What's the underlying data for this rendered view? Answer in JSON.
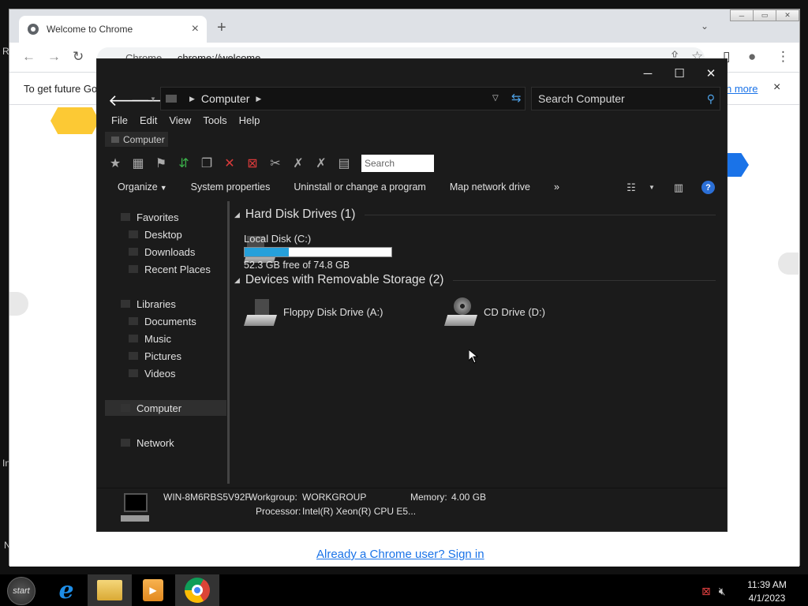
{
  "desktop": {
    "frag1": "R",
    "frag2": "In",
    "frag3": "N"
  },
  "chrome": {
    "tab_title": "Welcome to Chrome",
    "tab_close": "×",
    "new_tab": "+",
    "tab_search": "⌄",
    "win_min": "─",
    "win_max": "▭",
    "win_close": "✕",
    "site_label": "Chrome",
    "url": "chrome://welcome",
    "infobar_text": "To get future Go",
    "infobar_link": "n more",
    "infobar_close": "×",
    "signin_link": "Already a Chrome user? Sign in"
  },
  "explorer": {
    "caption": {
      "min": "─",
      "max": "☐",
      "close": "✕"
    },
    "address": {
      "location": "Computer"
    },
    "search_placeholder": "Search Computer",
    "menu": [
      "File",
      "Edit",
      "View",
      "Tools",
      "Help"
    ],
    "breadcrumb": "Computer",
    "toolbar_search": "Search",
    "commands": {
      "organize": "Organize",
      "system_properties": "System properties",
      "uninstall": "Uninstall or change a program",
      "map_drive": "Map network drive",
      "more": "»"
    },
    "nav": {
      "favorites": "Favorites",
      "desktop": "Desktop",
      "downloads": "Downloads",
      "recent": "Recent Places",
      "libraries": "Libraries",
      "documents": "Documents",
      "music": "Music",
      "pictures": "Pictures",
      "videos": "Videos",
      "computer": "Computer",
      "network": "Network"
    },
    "groups": {
      "hdd": "Hard Disk Drives (1)",
      "removable": "Devices with Removable Storage (2)"
    },
    "drives": {
      "local_c": {
        "name": "Local Disk (C:)",
        "free_text": "52.3 GB free of 74.8 GB",
        "used_fraction": 0.3
      },
      "floppy": "Floppy Disk Drive (A:)",
      "cd": "CD Drive (D:)"
    },
    "details": {
      "computer_name": "WIN-8M6RBS5V92F",
      "workgroup_label": "Workgroup:",
      "workgroup": "WORKGROUP",
      "memory_label": "Memory:",
      "memory": "4.00 GB",
      "processor_label": "Processor:",
      "processor": "Intel(R) Xeon(R) CPU E5..."
    }
  },
  "taskbar": {
    "start_label": "start",
    "time": "11:39 AM",
    "date": "4/1/2023"
  },
  "colors": {
    "accent": "#26a0da",
    "link": "#1a73e8",
    "explorer_bg": "#1b1b1b"
  }
}
